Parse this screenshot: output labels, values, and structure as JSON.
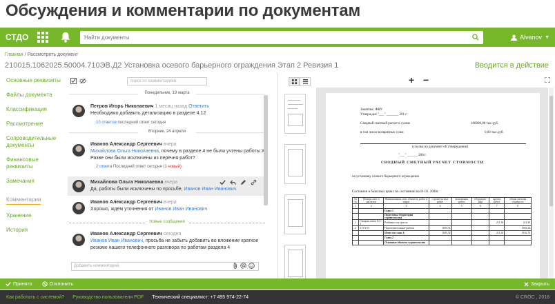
{
  "headline": "Обсуждения и комментарии по документам",
  "topbar": {
    "logo": "СТДО",
    "search_placeholder": "Найти документы",
    "user": "Alvanov"
  },
  "breadcrumb": {
    "home": "Главная",
    "sep": " / ",
    "current": "Рассмотреть документ"
  },
  "document": {
    "title": "210015.1062025.50004.710ЭВ.Д2 Установка осевого барьерного ограждения Этап 2 Ревизия 1",
    "status": "Вводится в действие"
  },
  "leftnav": [
    "Основные реквизиты",
    "Файлы документа",
    "Классификация",
    "Рассмотрение",
    "Сопроводительные документы",
    "Финансовые реквизиты",
    "Замечания",
    "Комментарии",
    "Хранение",
    "История"
  ],
  "comments_panel": {
    "search_placeholder": "поиск по комментариям",
    "date1": "Понедельник, 19 марта",
    "date2": "Вторник, 24 апреля",
    "new_sep": "Новые сообщения",
    "input_placeholder": "Добавить комментарий",
    "items": [
      {
        "author": "Петров Игорь Николаевич",
        "when": "1 месяц назад",
        "reply": "Ответить",
        "text": "Необходимо добавить детализацию в разделе 4.12",
        "meta_link": "10 ответов",
        "meta": "последний ответ сегодня"
      },
      {
        "author": "Иванов Александр Сергеевич",
        "when": "вчера",
        "mention": "Михайлова Ольга Николаевна",
        "text": ", почему в разделе 4 не были учтены работы X. Разве они были исключены из перечня работ?",
        "meta_link": "2 ответа",
        "meta": "Последний ответ сегодня",
        "meta_new": "(1 новый)"
      },
      {
        "author": "Михайлова Ольга Николаевна",
        "when": "вчера",
        "text": "Да, работы были исключены по просьбе,",
        "mention": "Иванов Иван Иванович"
      },
      {
        "author": "Иванов Александр Сергеевич",
        "when": "вчера",
        "text": "Хорошо, ждем уточнения от",
        "mention": "Иванов Иван Иванович"
      },
      {
        "author": "Иванов Александр Сергеевич",
        "when": "сегодня",
        "mention": "Иванов Иван Иванович",
        "text": ", просьба не забыть добавить во вложение краткое резюме нашего телефонного разговора по работам раздела 4"
      }
    ]
  },
  "doc_page": {
    "line1": "Заказчик:   ФКУ",
    "line2": "Утвержден  \"___\" _______ 201 г.",
    "line3": "Сводный сметный расчет в сумме",
    "line3v": "100000,00 тыс.руб.",
    "line4": "в том числе возвратных сумм",
    "line4v": "0,00 тыс.руб.",
    "line5": "(ссылка на документ об утверждении)",
    "line6": "\"___\" ______ 200 г.",
    "title": "СВОДНЫЙ СМЕТНЫЙ РАСЧЕТ СТОИМОСТИ",
    "line7": "на установку осевого барьерного ограждения",
    "line8": "Составлен в базисных ценах по состоянию на 01.01. 2000г.",
    "table": [
      [
        "№№",
        "Номера смет и расчетов",
        "Наименование глав, объектов, работ и затрат",
        "строитель-ных работ",
        "монтажных работ",
        "оборудова-ния",
        "прочих работ",
        "общая сметная стоимость"
      ],
      [
        "1",
        "2",
        "3",
        "4",
        "5",
        "6",
        "7",
        "8"
      ],
      [
        "",
        "",
        "Глава 1",
        "",
        "",
        "",
        "",
        ""
      ],
      [
        "",
        "",
        "Подготовка территории строительства",
        "",
        "",
        "",
        "",
        ""
      ],
      [
        "1",
        "Сводная смета №1-1",
        "Разбивка оси трассы",
        "",
        "",
        "",
        "211,36",
        "211,36"
      ],
      [
        "2",
        "01-01-01",
        "Подготовительные работы",
        "1605,34",
        "",
        "",
        "",
        "1605,34"
      ],
      [
        "",
        "",
        "Итого по главе 1:",
        "1605,34",
        "",
        "",
        "211,36",
        "1816,70"
      ],
      [
        "",
        "",
        "Глава 2",
        "",
        "",
        "",
        "",
        ""
      ],
      [
        "",
        "",
        "Основные объекты строительства",
        "",
        "",
        "",
        "",
        ""
      ]
    ]
  },
  "bottombar": {
    "accept": "Принято",
    "reject": "Отклонить",
    "close": "Закрыть"
  },
  "footer": {
    "how": "Как работать с системой?",
    "guide": "Руководство пользователя PDF",
    "support": "Технический специалист: +7 495 974-22-74",
    "copyright": "© CROC , 2018"
  },
  "colors": {
    "accent": "#76b82a",
    "link": "#3a7bd5",
    "footer": "#333333"
  }
}
